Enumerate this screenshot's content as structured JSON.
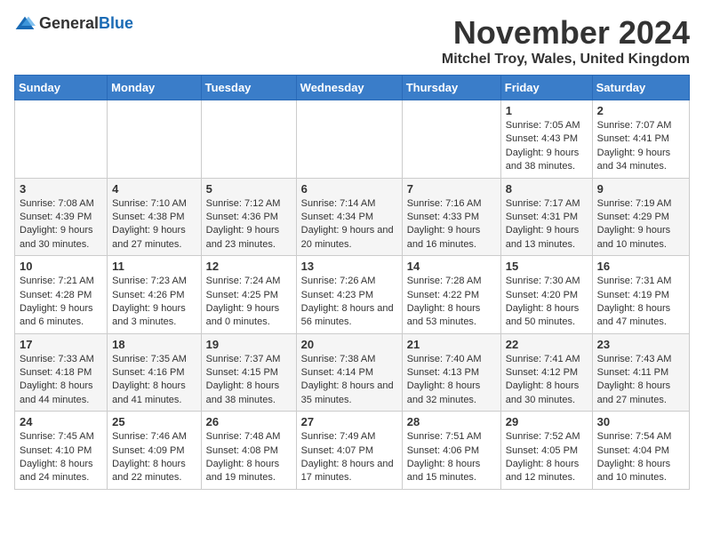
{
  "logo": {
    "general": "General",
    "blue": "Blue"
  },
  "title": "November 2024",
  "location": "Mitchel Troy, Wales, United Kingdom",
  "days_of_week": [
    "Sunday",
    "Monday",
    "Tuesday",
    "Wednesday",
    "Thursday",
    "Friday",
    "Saturday"
  ],
  "weeks": [
    [
      {
        "day": "",
        "info": ""
      },
      {
        "day": "",
        "info": ""
      },
      {
        "day": "",
        "info": ""
      },
      {
        "day": "",
        "info": ""
      },
      {
        "day": "",
        "info": ""
      },
      {
        "day": "1",
        "info": "Sunrise: 7:05 AM\nSunset: 4:43 PM\nDaylight: 9 hours and 38 minutes."
      },
      {
        "day": "2",
        "info": "Sunrise: 7:07 AM\nSunset: 4:41 PM\nDaylight: 9 hours and 34 minutes."
      }
    ],
    [
      {
        "day": "3",
        "info": "Sunrise: 7:08 AM\nSunset: 4:39 PM\nDaylight: 9 hours and 30 minutes."
      },
      {
        "day": "4",
        "info": "Sunrise: 7:10 AM\nSunset: 4:38 PM\nDaylight: 9 hours and 27 minutes."
      },
      {
        "day": "5",
        "info": "Sunrise: 7:12 AM\nSunset: 4:36 PM\nDaylight: 9 hours and 23 minutes."
      },
      {
        "day": "6",
        "info": "Sunrise: 7:14 AM\nSunset: 4:34 PM\nDaylight: 9 hours and 20 minutes."
      },
      {
        "day": "7",
        "info": "Sunrise: 7:16 AM\nSunset: 4:33 PM\nDaylight: 9 hours and 16 minutes."
      },
      {
        "day": "8",
        "info": "Sunrise: 7:17 AM\nSunset: 4:31 PM\nDaylight: 9 hours and 13 minutes."
      },
      {
        "day": "9",
        "info": "Sunrise: 7:19 AM\nSunset: 4:29 PM\nDaylight: 9 hours and 10 minutes."
      }
    ],
    [
      {
        "day": "10",
        "info": "Sunrise: 7:21 AM\nSunset: 4:28 PM\nDaylight: 9 hours and 6 minutes."
      },
      {
        "day": "11",
        "info": "Sunrise: 7:23 AM\nSunset: 4:26 PM\nDaylight: 9 hours and 3 minutes."
      },
      {
        "day": "12",
        "info": "Sunrise: 7:24 AM\nSunset: 4:25 PM\nDaylight: 9 hours and 0 minutes."
      },
      {
        "day": "13",
        "info": "Sunrise: 7:26 AM\nSunset: 4:23 PM\nDaylight: 8 hours and 56 minutes."
      },
      {
        "day": "14",
        "info": "Sunrise: 7:28 AM\nSunset: 4:22 PM\nDaylight: 8 hours and 53 minutes."
      },
      {
        "day": "15",
        "info": "Sunrise: 7:30 AM\nSunset: 4:20 PM\nDaylight: 8 hours and 50 minutes."
      },
      {
        "day": "16",
        "info": "Sunrise: 7:31 AM\nSunset: 4:19 PM\nDaylight: 8 hours and 47 minutes."
      }
    ],
    [
      {
        "day": "17",
        "info": "Sunrise: 7:33 AM\nSunset: 4:18 PM\nDaylight: 8 hours and 44 minutes."
      },
      {
        "day": "18",
        "info": "Sunrise: 7:35 AM\nSunset: 4:16 PM\nDaylight: 8 hours and 41 minutes."
      },
      {
        "day": "19",
        "info": "Sunrise: 7:37 AM\nSunset: 4:15 PM\nDaylight: 8 hours and 38 minutes."
      },
      {
        "day": "20",
        "info": "Sunrise: 7:38 AM\nSunset: 4:14 PM\nDaylight: 8 hours and 35 minutes."
      },
      {
        "day": "21",
        "info": "Sunrise: 7:40 AM\nSunset: 4:13 PM\nDaylight: 8 hours and 32 minutes."
      },
      {
        "day": "22",
        "info": "Sunrise: 7:41 AM\nSunset: 4:12 PM\nDaylight: 8 hours and 30 minutes."
      },
      {
        "day": "23",
        "info": "Sunrise: 7:43 AM\nSunset: 4:11 PM\nDaylight: 8 hours and 27 minutes."
      }
    ],
    [
      {
        "day": "24",
        "info": "Sunrise: 7:45 AM\nSunset: 4:10 PM\nDaylight: 8 hours and 24 minutes."
      },
      {
        "day": "25",
        "info": "Sunrise: 7:46 AM\nSunset: 4:09 PM\nDaylight: 8 hours and 22 minutes."
      },
      {
        "day": "26",
        "info": "Sunrise: 7:48 AM\nSunset: 4:08 PM\nDaylight: 8 hours and 19 minutes."
      },
      {
        "day": "27",
        "info": "Sunrise: 7:49 AM\nSunset: 4:07 PM\nDaylight: 8 hours and 17 minutes."
      },
      {
        "day": "28",
        "info": "Sunrise: 7:51 AM\nSunset: 4:06 PM\nDaylight: 8 hours and 15 minutes."
      },
      {
        "day": "29",
        "info": "Sunrise: 7:52 AM\nSunset: 4:05 PM\nDaylight: 8 hours and 12 minutes."
      },
      {
        "day": "30",
        "info": "Sunrise: 7:54 AM\nSunset: 4:04 PM\nDaylight: 8 hours and 10 minutes."
      }
    ]
  ]
}
